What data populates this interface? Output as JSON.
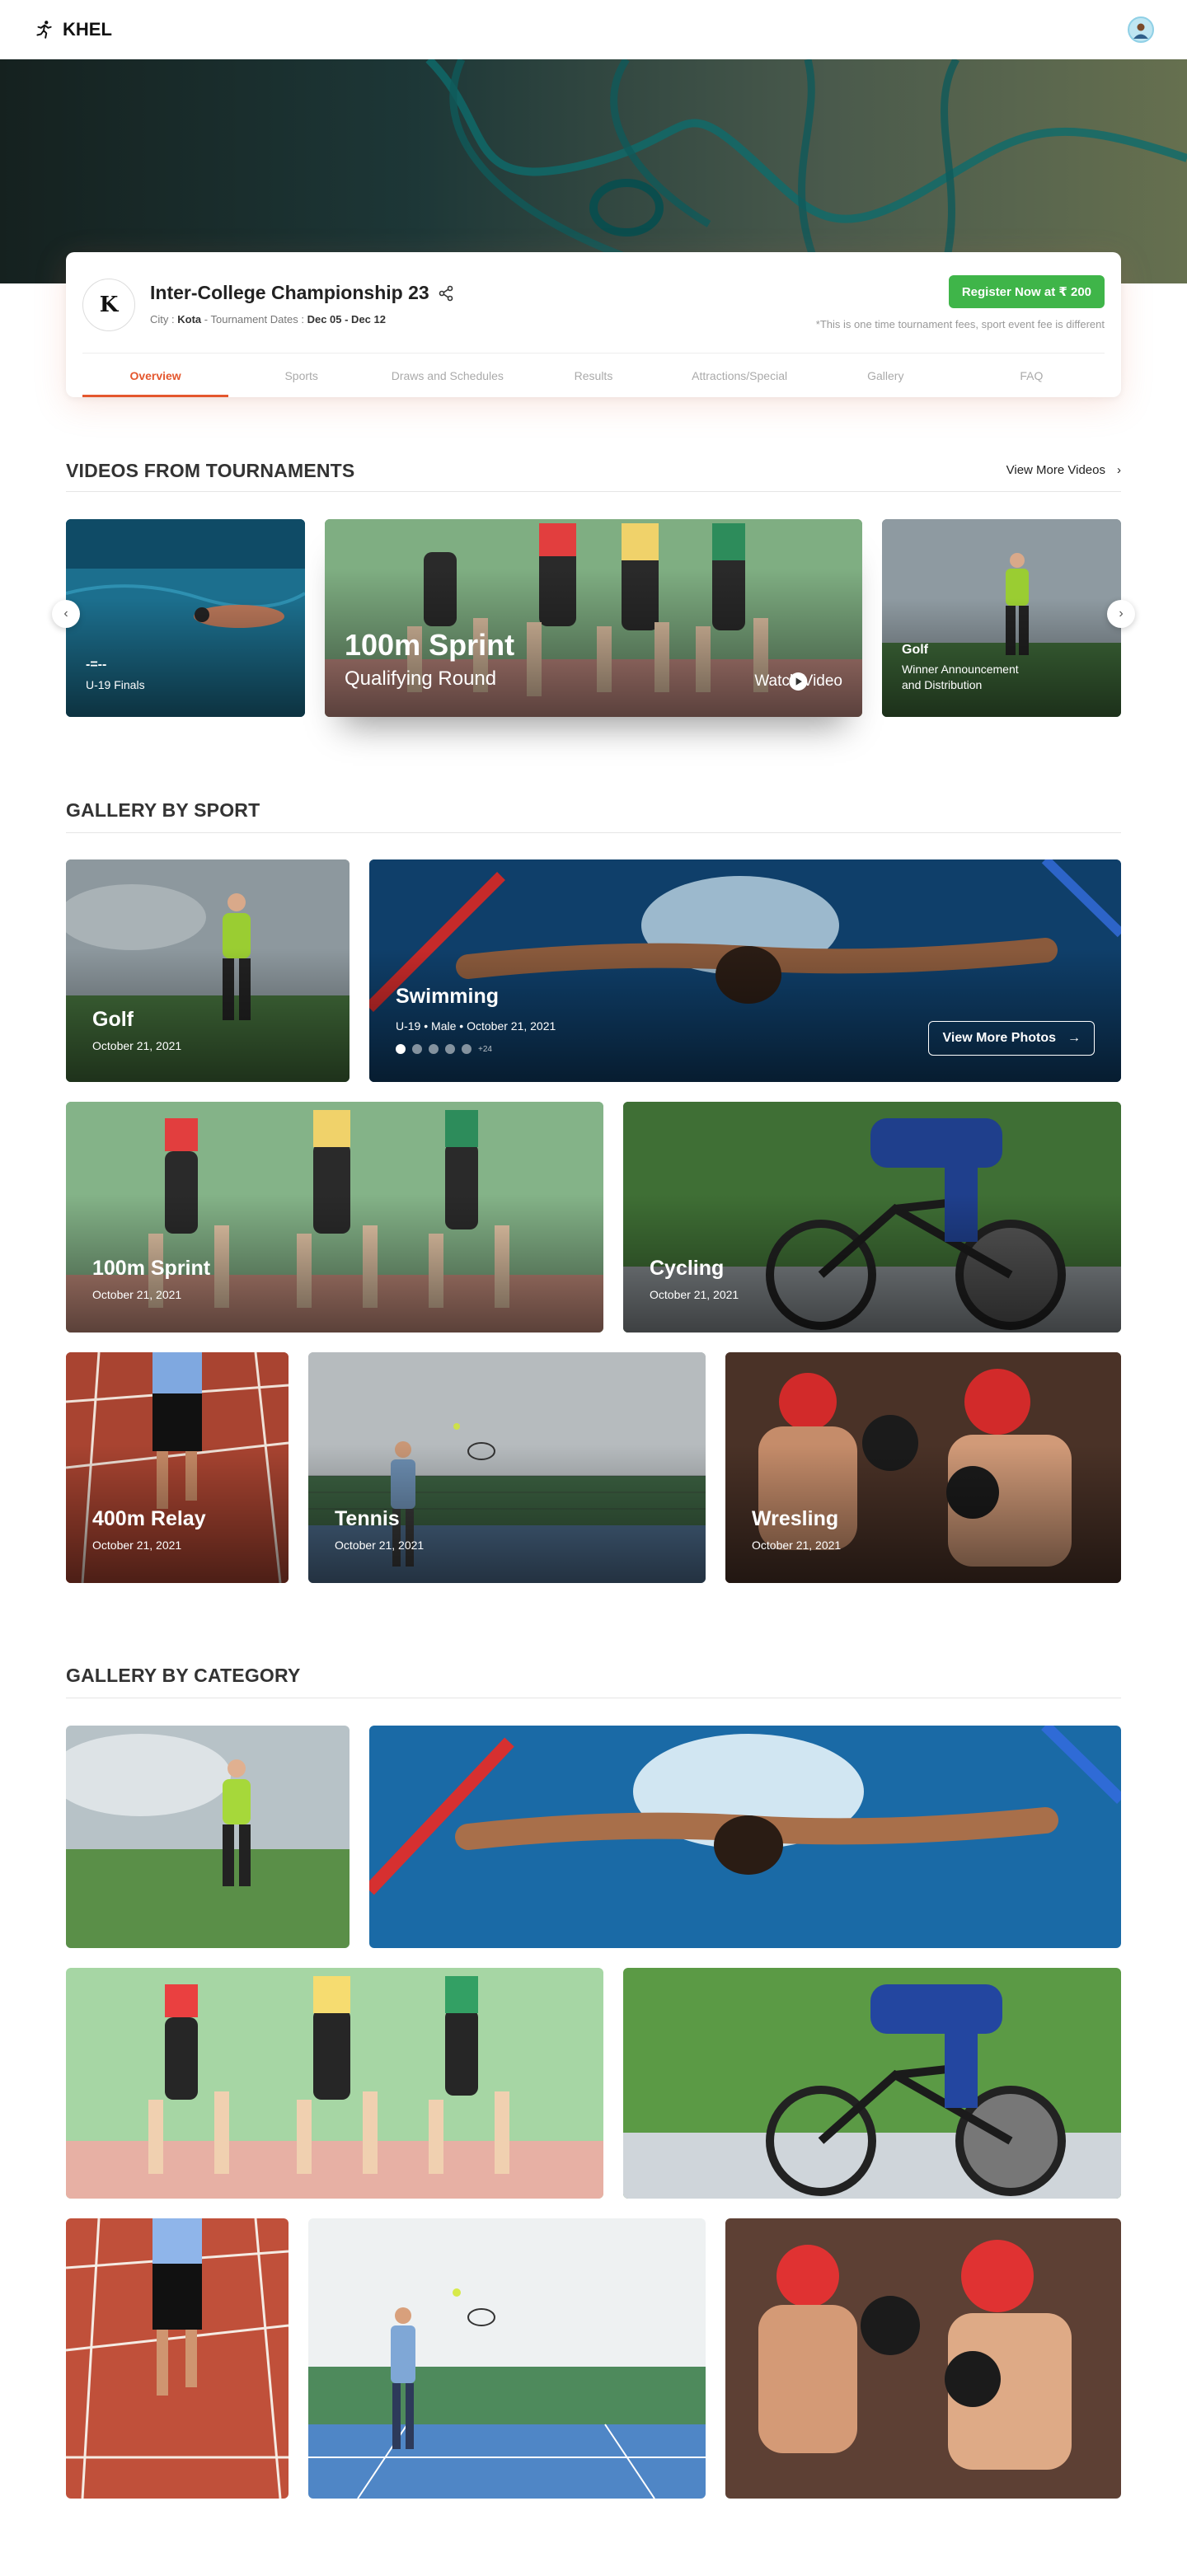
{
  "brand": {
    "name": "KHEL",
    "icon": "runner-icon"
  },
  "tournament": {
    "logo_letter": "K",
    "title": "Inter-College Championship 23",
    "city_label": "City :",
    "city": "Kota",
    "separator": "-",
    "dates_label": "Tournament Dates :",
    "dates": "Dec 05 - Dec 12",
    "register_label": "Register Now at ₹ 200",
    "fee_note": "*This is one time tournament fees, sport event fee is different",
    "tabs": [
      "Overview",
      "Sports",
      "Draws and Schedules",
      "Results",
      "Attractions/Special",
      "Gallery",
      "FAQ"
    ]
  },
  "videos": {
    "title": "VIDEOS FROM TOURNAMENTS",
    "more_label": "View More Videos",
    "items": [
      {
        "title": "-=--",
        "subtitle": "U-19 Finals"
      },
      {
        "title": "100m Sprint",
        "subtitle": "Qualifying Round",
        "action": "Watch Video"
      },
      {
        "title": "Golf",
        "subtitle_line1": "Winner Announcement",
        "subtitle_line2": "and Distribution"
      }
    ]
  },
  "gallery_sport": {
    "title": "GALLERY BY SPORT",
    "items": [
      {
        "name": "Golf",
        "date": "October 21, 2021"
      },
      {
        "name": "Swimming",
        "age": "U-19",
        "gender": "Male",
        "date": "October 21, 2021",
        "more_count": "+24",
        "action": "View More Photos"
      },
      {
        "name": "100m Sprint",
        "date": "October 21, 2021"
      },
      {
        "name": "Cycling",
        "date": "October 21, 2021"
      },
      {
        "name": "400m Relay",
        "date": "October 21, 2021"
      },
      {
        "name": "Tennis",
        "date": "October 21, 2021"
      },
      {
        "name": "Wresling",
        "date": "October 21, 2021"
      }
    ]
  },
  "gallery_category": {
    "title": "GALLERY BY CATEGORY"
  },
  "colors": {
    "accent": "#e4572e",
    "register": "#3fb549",
    "text": "#222222"
  }
}
